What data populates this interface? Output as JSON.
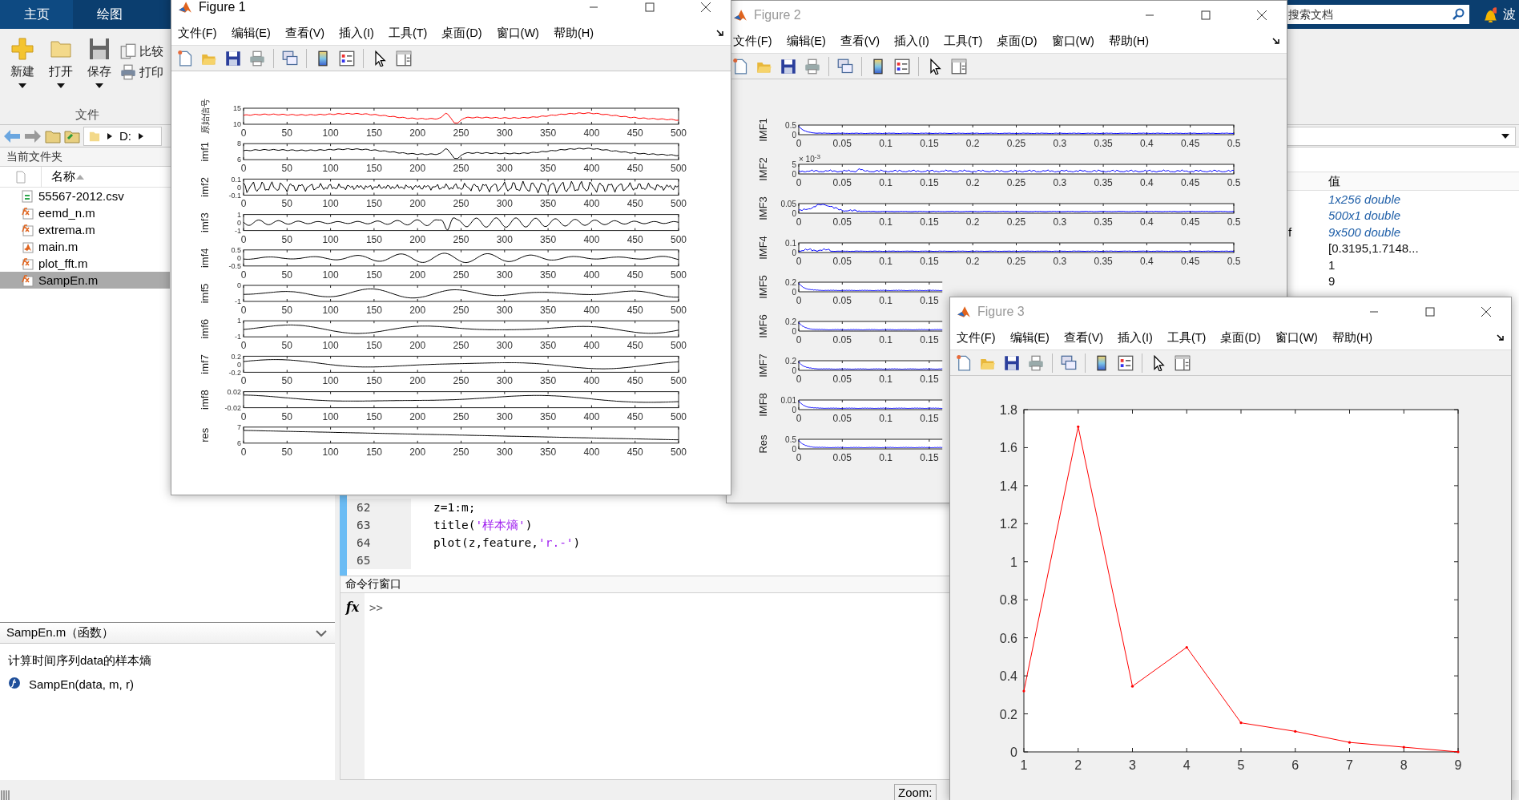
{
  "desktop": {
    "tabs": [
      {
        "label": "主页",
        "selected": true
      },
      {
        "label": "绘图",
        "selected": false
      }
    ],
    "search": {
      "placeholder": "搜索文档"
    },
    "user_label": "波",
    "ribbon": {
      "buttons": [
        {
          "label": "新建",
          "kind": "large"
        },
        {
          "label": "打开",
          "kind": "large"
        },
        {
          "label": "保存",
          "kind": "large"
        },
        {
          "label": "比较",
          "kind": "small"
        },
        {
          "label": "打印",
          "kind": "small"
        }
      ],
      "section": "文件"
    },
    "address": {
      "path": [
        "D:"
      ]
    },
    "current_folder": {
      "title": "当前文件夹",
      "column": "名称",
      "files": [
        {
          "name": "55567-2012.csv",
          "kind": "csv",
          "selected": false
        },
        {
          "name": "eemd_n.m",
          "kind": "function",
          "selected": false
        },
        {
          "name": "extrema.m",
          "kind": "function",
          "selected": false
        },
        {
          "name": "main.m",
          "kind": "script",
          "selected": false
        },
        {
          "name": "plot_fft.m",
          "kind": "function",
          "selected": false
        },
        {
          "name": "SampEn.m",
          "kind": "function",
          "selected": true
        }
      ]
    },
    "details": {
      "title": "SampEn.m（函数）",
      "description": "计算时间序列data的样本熵",
      "signature": "SampEn(data, m, r)"
    },
    "editor": {
      "lines": [
        {
          "number": "62",
          "code": [
            {
              "text": "z=1:m;",
              "kind": "plain"
            }
          ]
        },
        {
          "number": "63",
          "code": [
            {
              "text": "title(",
              "kind": "plain"
            },
            {
              "text": "'样本熵'",
              "kind": "string"
            },
            {
              "text": ")",
              "kind": "plain"
            }
          ]
        },
        {
          "number": "64",
          "code": [
            {
              "text": "plot(z,feature,",
              "kind": "plain"
            },
            {
              "text": "'r.-'",
              "kind": "string"
            },
            {
              "text": ")",
              "kind": "plain"
            }
          ]
        },
        {
          "number": "65"
        }
      ]
    },
    "command_window": {
      "title": "命令行窗口",
      "prompt_icon": "fx",
      "prompt": ">>"
    },
    "workspace": {
      "column": "值",
      "rows": [
        {
          "value": "1x256 double",
          "kind": "array"
        },
        {
          "value": "500x1 double",
          "kind": "array"
        },
        {
          "name": "f",
          "value": "9x500 double",
          "kind": "array"
        },
        {
          "value": "[0.3195,1.7148...",
          "kind": "value"
        },
        {
          "value": "1",
          "kind": "value"
        },
        {
          "value": "9",
          "kind": "value"
        }
      ]
    },
    "status_bar": {
      "zoom": "Zoom:"
    }
  },
  "figures": [
    {
      "title": "Figure 1",
      "active": true,
      "menu": [
        "文件(F)",
        "编辑(E)",
        "查看(V)",
        "插入(I)",
        "工具(T)",
        "桌面(D)",
        "窗口(W)",
        "帮助(H)"
      ],
      "subplots": [
        {
          "ylabel": "原始信号",
          "color": "#ff0000",
          "yticks": [
            "15",
            "10"
          ],
          "xticks": [
            "0",
            "50",
            "100",
            "150",
            "200",
            "250",
            "300",
            "350",
            "400",
            "450",
            "500"
          ]
        },
        {
          "ylabel": "imf1",
          "color": "#000000",
          "yticks": [
            "8",
            "6"
          ],
          "xticks": [
            "0",
            "50",
            "100",
            "150",
            "200",
            "250",
            "300",
            "350",
            "400",
            "450",
            "500"
          ]
        },
        {
          "ylabel": "imf2",
          "color": "#000000",
          "yticks": [
            "0.1",
            "0",
            "-0.1"
          ],
          "xticks": [
            "0",
            "50",
            "100",
            "150",
            "200",
            "250",
            "300",
            "350",
            "400",
            "450",
            "500"
          ]
        },
        {
          "ylabel": "imf3",
          "color": "#000000",
          "yticks": [
            "1",
            "0",
            "-1"
          ],
          "xticks": [
            "0",
            "50",
            "100",
            "150",
            "200",
            "250",
            "300",
            "350",
            "400",
            "450",
            "500"
          ]
        },
        {
          "ylabel": "imf4",
          "color": "#000000",
          "yticks": [
            "0.5",
            "0",
            "-0.5"
          ],
          "xticks": [
            "0",
            "50",
            "100",
            "150",
            "200",
            "250",
            "300",
            "350",
            "400",
            "450",
            "500"
          ]
        },
        {
          "ylabel": "imf5",
          "color": "#000000",
          "yticks": [
            "0",
            "-1"
          ],
          "xticks": [
            "0",
            "50",
            "100",
            "150",
            "200",
            "250",
            "300",
            "350",
            "400",
            "450",
            "500"
          ]
        },
        {
          "ylabel": "imf6",
          "color": "#000000",
          "yticks": [
            "1",
            "-1"
          ],
          "xticks": [
            "0",
            "50",
            "100",
            "150",
            "200",
            "250",
            "300",
            "350",
            "400",
            "450",
            "500"
          ]
        },
        {
          "ylabel": "imf7",
          "color": "#000000",
          "yticks": [
            "0.2",
            "0",
            "-0.2"
          ],
          "xticks": [
            "0",
            "50",
            "100",
            "150",
            "200",
            "250",
            "300",
            "350",
            "400",
            "450",
            "500"
          ]
        },
        {
          "ylabel": "imf8",
          "color": "#000000",
          "yticks": [
            "0.02",
            "-0.02"
          ],
          "xticks": [
            "0",
            "50",
            "100",
            "150",
            "200",
            "250",
            "300",
            "350",
            "400",
            "450",
            "500"
          ]
        },
        {
          "ylabel": "res",
          "color": "#000000",
          "yticks": [
            "7",
            "6"
          ],
          "xticks": [
            "0",
            "50",
            "100",
            "150",
            "200",
            "250",
            "300",
            "350",
            "400",
            "450",
            "500"
          ]
        }
      ]
    },
    {
      "title": "Figure 2",
      "active": false,
      "menu": [
        "文件(F)",
        "编辑(E)",
        "查看(V)",
        "插入(I)",
        "工具(T)",
        "桌面(D)",
        "窗口(W)",
        "帮助(H)"
      ],
      "subplots": [
        {
          "ylabel": "IMF1",
          "yticks": [
            "0.5",
            "0"
          ],
          "xticks": [
            "0",
            "0.05",
            "0.1",
            "0.15",
            "0.2",
            "0.25",
            "0.3",
            "0.35",
            "0.4",
            "0.45",
            "0.5"
          ]
        },
        {
          "ylabel": "IMF2",
          "yticks": [
            "5",
            "0"
          ],
          "multiplier": "× 10",
          "exponent": "-3",
          "xticks": [
            "0",
            "0.05",
            "0.1",
            "0.15",
            "0.2",
            "0.25",
            "0.3",
            "0.35",
            "0.4",
            "0.45",
            "0.5"
          ]
        },
        {
          "ylabel": "IMF3",
          "yticks": [
            "0.05",
            "0"
          ],
          "xticks": [
            "0",
            "0.05",
            "0.1",
            "0.15",
            "0.2",
            "0.25",
            "0.3",
            "0.35",
            "0.4",
            "0.45",
            "0.5"
          ]
        },
        {
          "ylabel": "IMF4",
          "yticks": [
            "0.1",
            "0"
          ],
          "xticks": [
            "0",
            "0.05",
            "0.1",
            "0.15",
            "0.2",
            "0.25",
            "0.3",
            "0.35",
            "0.4",
            "0.45",
            "0.5"
          ]
        },
        {
          "ylabel": "IMF5",
          "yticks": [
            "0.2",
            "0"
          ],
          "xticks": [
            "0",
            "0.05",
            "0.1",
            "0.15"
          ]
        },
        {
          "ylabel": "IMF6",
          "yticks": [
            "0.2",
            "0"
          ],
          "xticks": [
            "0",
            "0.05",
            "0.1",
            "0.15"
          ]
        },
        {
          "ylabel": "IMF7",
          "yticks": [
            "0.2",
            "0"
          ],
          "xticks": [
            "0",
            "0.05",
            "0.1",
            "0.15"
          ]
        },
        {
          "ylabel": "IMF8",
          "yticks": [
            "0.01",
            "0"
          ],
          "xticks": [
            "0",
            "0.05",
            "0.1",
            "0.15"
          ]
        },
        {
          "ylabel": "Res",
          "yticks": [
            "0.5",
            "0"
          ],
          "xticks": [
            "0",
            "0.05",
            "0.1",
            "0.15"
          ]
        }
      ]
    },
    {
      "title": "Figure 3",
      "active": false,
      "menu": [
        "文件(F)",
        "编辑(E)",
        "查看(V)",
        "插入(I)",
        "工具(T)",
        "桌面(D)",
        "窗口(W)",
        "帮助(H)"
      ],
      "chart_data": {
        "type": "line",
        "x": [
          1,
          2,
          3,
          4,
          5,
          6,
          7,
          8,
          9
        ],
        "series": [
          {
            "color": "#ff0000",
            "values": [
              0.32,
              1.71,
              0.345,
              0.55,
              0.153,
              0.108,
              0.05,
              0.025,
              0
            ]
          }
        ],
        "xlim": [
          1,
          9
        ],
        "ylim": [
          0,
          1.8
        ],
        "xticks": [
          1,
          2,
          3,
          4,
          5,
          6,
          7,
          8,
          9
        ],
        "yticks": [
          0,
          0.2,
          0.4,
          0.6,
          0.8,
          1,
          1.2,
          1.4,
          1.6,
          1.8
        ]
      }
    }
  ]
}
